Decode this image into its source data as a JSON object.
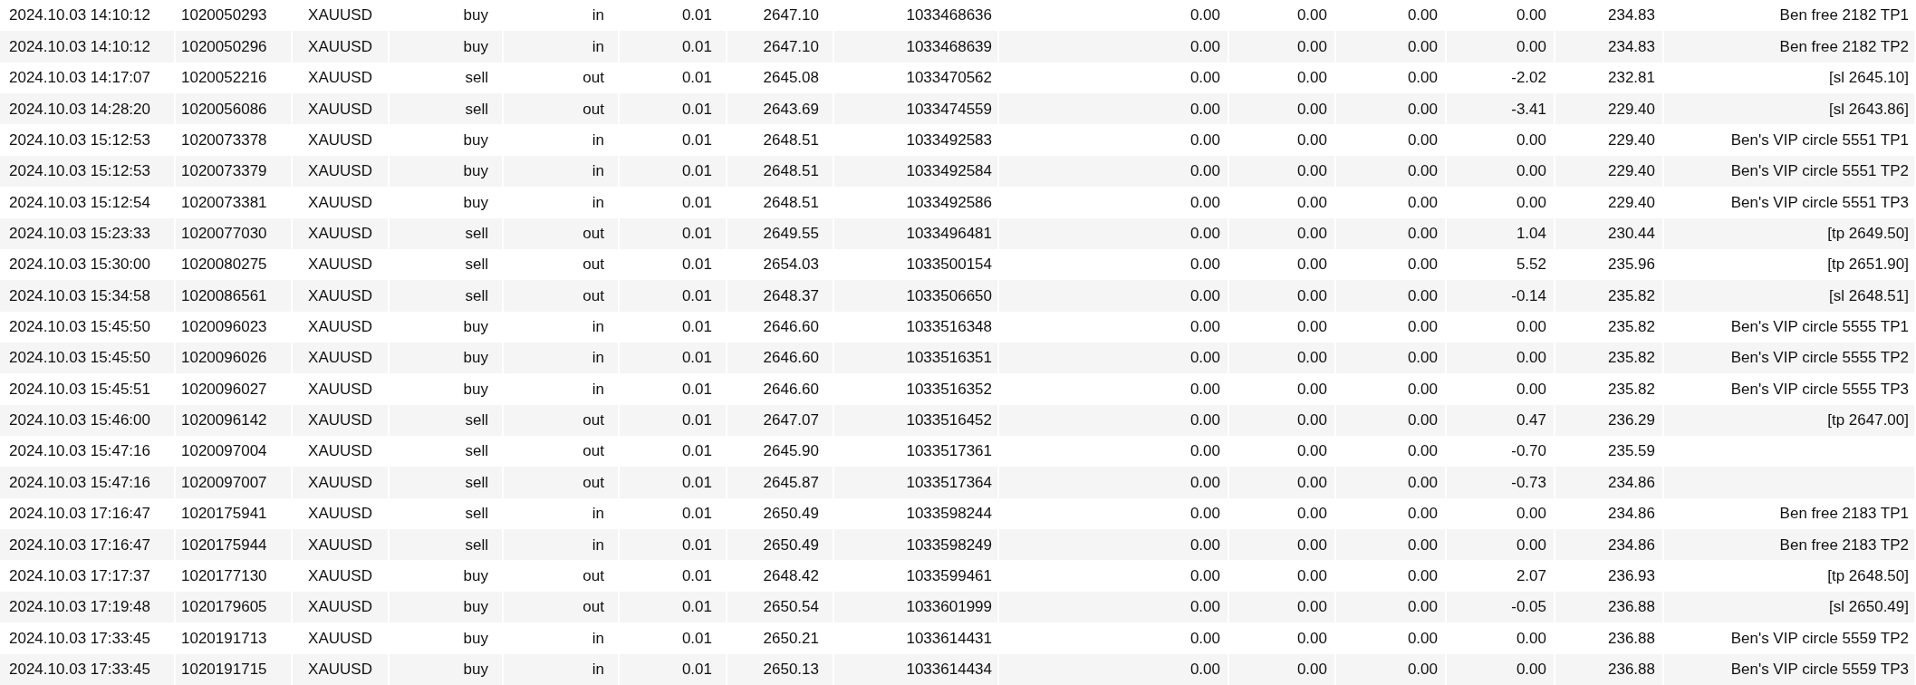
{
  "table": {
    "rows": [
      [
        "2024.10.03 14:10:12",
        "1020050293",
        "XAUUSD",
        "buy",
        "in",
        "0.01",
        "2647.10",
        "1033468636",
        "0.00",
        "0.00",
        "0.00",
        "0.00",
        "234.83",
        "Ben free 2182 TP1"
      ],
      [
        "2024.10.03 14:10:12",
        "1020050296",
        "XAUUSD",
        "buy",
        "in",
        "0.01",
        "2647.10",
        "1033468639",
        "0.00",
        "0.00",
        "0.00",
        "0.00",
        "234.83",
        "Ben free 2182 TP2"
      ],
      [
        "2024.10.03 14:17:07",
        "1020052216",
        "XAUUSD",
        "sell",
        "out",
        "0.01",
        "2645.08",
        "1033470562",
        "0.00",
        "0.00",
        "0.00",
        "-2.02",
        "232.81",
        "[sl 2645.10]"
      ],
      [
        "2024.10.03 14:28:20",
        "1020056086",
        "XAUUSD",
        "sell",
        "out",
        "0.01",
        "2643.69",
        "1033474559",
        "0.00",
        "0.00",
        "0.00",
        "-3.41",
        "229.40",
        "[sl 2643.86]"
      ],
      [
        "2024.10.03 15:12:53",
        "1020073378",
        "XAUUSD",
        "buy",
        "in",
        "0.01",
        "2648.51",
        "1033492583",
        "0.00",
        "0.00",
        "0.00",
        "0.00",
        "229.40",
        "Ben's VIP circle 5551 TP1"
      ],
      [
        "2024.10.03 15:12:53",
        "1020073379",
        "XAUUSD",
        "buy",
        "in",
        "0.01",
        "2648.51",
        "1033492584",
        "0.00",
        "0.00",
        "0.00",
        "0.00",
        "229.40",
        "Ben's VIP circle 5551 TP2"
      ],
      [
        "2024.10.03 15:12:54",
        "1020073381",
        "XAUUSD",
        "buy",
        "in",
        "0.01",
        "2648.51",
        "1033492586",
        "0.00",
        "0.00",
        "0.00",
        "0.00",
        "229.40",
        "Ben's VIP circle 5551 TP3"
      ],
      [
        "2024.10.03 15:23:33",
        "1020077030",
        "XAUUSD",
        "sell",
        "out",
        "0.01",
        "2649.55",
        "1033496481",
        "0.00",
        "0.00",
        "0.00",
        "1.04",
        "230.44",
        "[tp 2649.50]"
      ],
      [
        "2024.10.03 15:30:00",
        "1020080275",
        "XAUUSD",
        "sell",
        "out",
        "0.01",
        "2654.03",
        "1033500154",
        "0.00",
        "0.00",
        "0.00",
        "5.52",
        "235.96",
        "[tp 2651.90]"
      ],
      [
        "2024.10.03 15:34:58",
        "1020086561",
        "XAUUSD",
        "sell",
        "out",
        "0.01",
        "2648.37",
        "1033506650",
        "0.00",
        "0.00",
        "0.00",
        "-0.14",
        "235.82",
        "[sl 2648.51]"
      ],
      [
        "2024.10.03 15:45:50",
        "1020096023",
        "XAUUSD",
        "buy",
        "in",
        "0.01",
        "2646.60",
        "1033516348",
        "0.00",
        "0.00",
        "0.00",
        "0.00",
        "235.82",
        "Ben's VIP circle 5555 TP1"
      ],
      [
        "2024.10.03 15:45:50",
        "1020096026",
        "XAUUSD",
        "buy",
        "in",
        "0.01",
        "2646.60",
        "1033516351",
        "0.00",
        "0.00",
        "0.00",
        "0.00",
        "235.82",
        "Ben's VIP circle 5555 TP2"
      ],
      [
        "2024.10.03 15:45:51",
        "1020096027",
        "XAUUSD",
        "buy",
        "in",
        "0.01",
        "2646.60",
        "1033516352",
        "0.00",
        "0.00",
        "0.00",
        "0.00",
        "235.82",
        "Ben's VIP circle 5555 TP3"
      ],
      [
        "2024.10.03 15:46:00",
        "1020096142",
        "XAUUSD",
        "sell",
        "out",
        "0.01",
        "2647.07",
        "1033516452",
        "0.00",
        "0.00",
        "0.00",
        "0.47",
        "236.29",
        "[tp 2647.00]"
      ],
      [
        "2024.10.03 15:47:16",
        "1020097004",
        "XAUUSD",
        "sell",
        "out",
        "0.01",
        "2645.90",
        "1033517361",
        "0.00",
        "0.00",
        "0.00",
        "-0.70",
        "235.59"
      ],
      [
        "2024.10.03 15:47:16",
        "1020097007",
        "XAUUSD",
        "sell",
        "out",
        "0.01",
        "2645.87",
        "1033517364",
        "0.00",
        "0.00",
        "0.00",
        "-0.73",
        "234.86"
      ],
      [
        "2024.10.03 17:16:47",
        "1020175941",
        "XAUUSD",
        "sell",
        "in",
        "0.01",
        "2650.49",
        "1033598244",
        "0.00",
        "0.00",
        "0.00",
        "0.00",
        "234.86",
        "Ben free 2183 TP1"
      ],
      [
        "2024.10.03 17:16:47",
        "1020175944",
        "XAUUSD",
        "sell",
        "in",
        "0.01",
        "2650.49",
        "1033598249",
        "0.00",
        "0.00",
        "0.00",
        "0.00",
        "234.86",
        "Ben free 2183 TP2"
      ],
      [
        "2024.10.03 17:17:37",
        "1020177130",
        "XAUUSD",
        "buy",
        "out",
        "0.01",
        "2648.42",
        "1033599461",
        "0.00",
        "0.00",
        "0.00",
        "2.07",
        "236.93",
        "[tp 2648.50]"
      ],
      [
        "2024.10.03 17:19:48",
        "1020179605",
        "XAUUSD",
        "buy",
        "out",
        "0.01",
        "2650.54",
        "1033601999",
        "0.00",
        "0.00",
        "0.00",
        "-0.05",
        "236.88",
        "[sl 2650.49]"
      ],
      [
        "2024.10.03 17:33:45",
        "1020191713",
        "XAUUSD",
        "buy",
        "in",
        "0.01",
        "2650.21",
        "1033614431",
        "0.00",
        "0.00",
        "0.00",
        "0.00",
        "236.88",
        "Ben's VIP circle 5559 TP2"
      ],
      [
        "2024.10.03 17:33:45",
        "1020191715",
        "XAUUSD",
        "buy",
        "in",
        "0.01",
        "2650.13",
        "1033614434",
        "0.00",
        "0.00",
        "0.00",
        "0.00",
        "236.88",
        "Ben's VIP circle 5559 TP3"
      ]
    ]
  }
}
